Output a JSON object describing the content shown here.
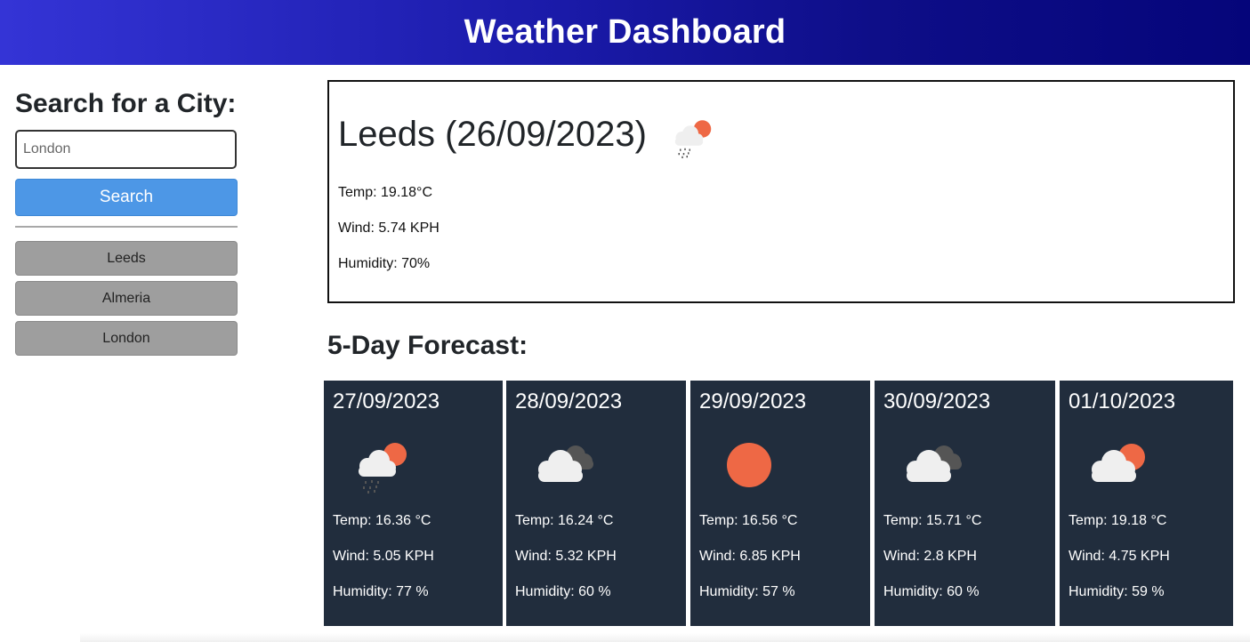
{
  "header": {
    "title": "Weather Dashboard"
  },
  "sidebar": {
    "heading": "Search for a City:",
    "search_value": "",
    "search_placeholder": "London",
    "search_button": "Search",
    "history": [
      "Leeds",
      "Almeria",
      "London"
    ]
  },
  "current": {
    "title": "Leeds (26/09/2023)",
    "icon": "light-rain-partly-cloudy-icon",
    "temp": "Temp: 19.18°C",
    "wind": "Wind: 5.74 KPH",
    "humidity": "Humidity: 70%"
  },
  "forecast": {
    "heading": "5-Day Forecast:",
    "days": [
      {
        "date": "27/09/2023",
        "icon": "light-rain-partly-cloudy-icon",
        "temp": "Temp: 16.36 °C",
        "wind": "Wind: 5.05 KPH",
        "humidity": "Humidity: 77 %"
      },
      {
        "date": "28/09/2023",
        "icon": "broken-clouds-icon",
        "temp": "Temp: 16.24 °C",
        "wind": "Wind: 5.32 KPH",
        "humidity": "Humidity: 60 %"
      },
      {
        "date": "29/09/2023",
        "icon": "clear-sky-icon",
        "temp": "Temp: 16.56 °C",
        "wind": "Wind: 6.85 KPH",
        "humidity": "Humidity: 57 %"
      },
      {
        "date": "30/09/2023",
        "icon": "broken-clouds-icon",
        "temp": "Temp: 15.71 °C",
        "wind": "Wind: 2.8 KPH",
        "humidity": "Humidity: 60 %"
      },
      {
        "date": "01/10/2023",
        "icon": "few-clouds-icon",
        "temp": "Temp: 19.18 °C",
        "wind": "Wind: 4.75 KPH",
        "humidity": "Humidity: 59 %"
      }
    ]
  },
  "colors": {
    "header_start": "#3434d6",
    "header_end": "#05057a",
    "search_button": "#4d97e6",
    "history_button": "#9e9e9e",
    "card_bg": "#212d3d",
    "sun": "#ee6845"
  }
}
